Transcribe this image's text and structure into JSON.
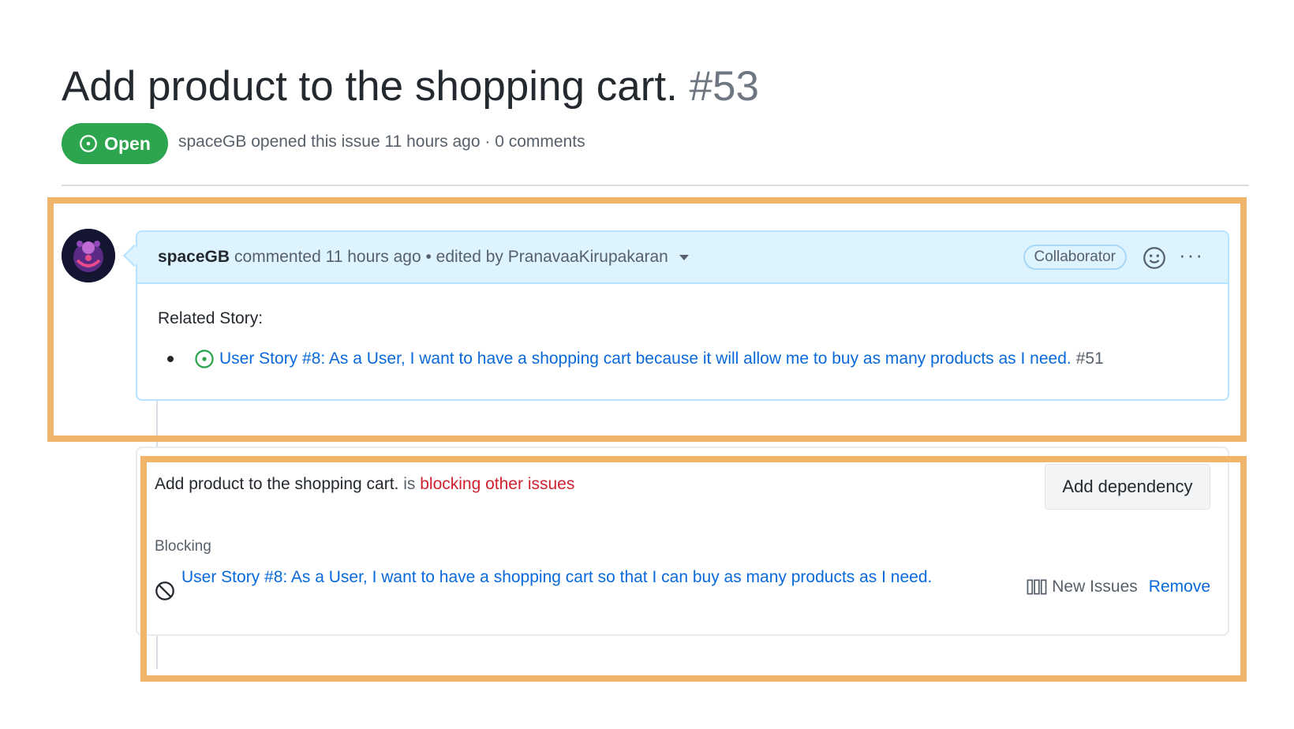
{
  "issue": {
    "title": "Add product to the shopping cart.",
    "number": "#53",
    "state": "Open",
    "meta": "spaceGB opened this issue 11 hours ago · 0 comments"
  },
  "comment": {
    "author": "spaceGB",
    "action": "commented 11 hours ago • edited by PranavaaKirupakaran",
    "role": "Collaborator",
    "more": "···",
    "related_label": "Related Story:",
    "story_link": "User Story #8: As a User, I want to have a shopping cart because it will allow me to buy as many products as I need.",
    "story_number": "#51"
  },
  "dependencies": {
    "issue_title": "Add product to the shopping cart.",
    "is_text": "is",
    "status": "blocking other issues",
    "add_button": "Add dependency",
    "section_label": "Blocking",
    "blocked_issue": "User Story #8: As a User, I want to have a shopping cart so that I can buy as many products as I need.",
    "project": "New Issues",
    "remove": "Remove"
  },
  "colors": {
    "open_green": "#2da44e",
    "link_blue": "#0969da",
    "blocking_red": "#cf222e",
    "highlight_orange": "#f0b46a",
    "header_blue": "#ddf4ff"
  },
  "icons": [
    "issue-opened-icon",
    "smiley-icon",
    "kebab-horizontal-icon",
    "blocked-icon",
    "project-icon",
    "caret-down-icon"
  ]
}
